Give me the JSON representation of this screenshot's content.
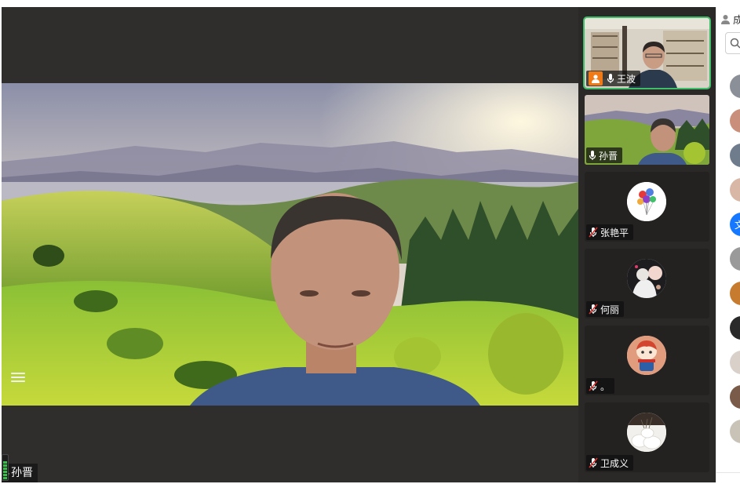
{
  "main": {
    "speaker_name": "孙晋",
    "meter_segments": 6
  },
  "thumbnails": [
    {
      "name": "王波",
      "mic": "on",
      "host": true,
      "active": true,
      "video": "office"
    },
    {
      "name": "孙晋",
      "mic": "on",
      "host": false,
      "active": false,
      "video": "landscape"
    },
    {
      "name": "张艳平",
      "mic": "muted",
      "host": false,
      "active": false,
      "avatar": "balloons"
    },
    {
      "name": "何丽",
      "mic": "muted",
      "host": false,
      "active": false,
      "avatar": "photo-dark"
    },
    {
      "name": "。",
      "mic": "muted",
      "host": false,
      "active": false,
      "avatar": "cartoon"
    },
    {
      "name": "卫成义",
      "mic": "muted",
      "host": false,
      "active": false,
      "avatar": "flowers"
    }
  ],
  "side_panel": {
    "header_text": "成",
    "search_icon": "search-icon",
    "member_avatars": [
      {
        "bg": "#8a8f98"
      },
      {
        "bg": "#c98f7a"
      },
      {
        "bg": "#6e7c8c"
      },
      {
        "bg": "#d8b7a6"
      },
      {
        "bg": "#1677ff",
        "text": "文"
      },
      {
        "bg": "#9a9a9a"
      },
      {
        "bg": "#c77b2e"
      },
      {
        "bg": "#2a2a2a"
      },
      {
        "bg": "#d9d0c9"
      },
      {
        "bg": "#7a5b4a"
      },
      {
        "bg": "#c9c2b6"
      }
    ]
  },
  "colors": {
    "active_outline": "#3fbf6a",
    "host_badge": "#f07b16",
    "muted_red": "#e0322f",
    "panel_bg": "#2b2927"
  }
}
